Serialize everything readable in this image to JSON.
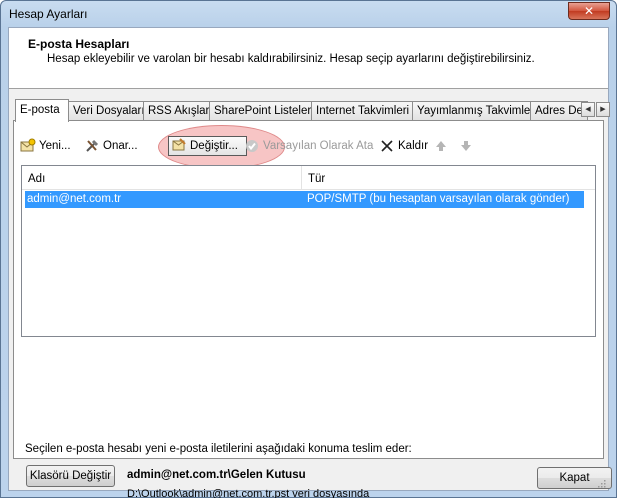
{
  "window": {
    "title": "Hesap Ayarları",
    "close_glyph": "✕"
  },
  "header": {
    "title": "E-posta Hesapları",
    "description": "Hesap ekleyebilir ve varolan bir hesabı kaldırabilirsiniz. Hesap seçip ayarlarını değiştirebilirsiniz."
  },
  "tabs": [
    {
      "label": "E-posta",
      "active": true
    },
    {
      "label": "Veri Dosyaları"
    },
    {
      "label": "RSS Akışları"
    },
    {
      "label": "SharePoint Listeleri"
    },
    {
      "label": "Internet Takvimleri"
    },
    {
      "label": "Yayımlanmış Takvimler"
    },
    {
      "label": "Adres De"
    }
  ],
  "toolbar": {
    "new": "Yeni...",
    "repair": "Onar...",
    "change": "Değiştir...",
    "set_default": "Varsayılan Olarak Ata",
    "remove": "Kaldır"
  },
  "table": {
    "columns": [
      "Adı",
      "Tür"
    ],
    "rows": [
      {
        "name": "admin@net.com.tr",
        "type": "POP/SMTP (bu hesaptan varsayılan olarak gönder)"
      }
    ]
  },
  "delivery": {
    "label": "Seçilen e-posta hesabı yeni e-posta iletilerini aşağıdaki konuma teslim eder:",
    "change_folder_button": "Klasörü Değiştir",
    "location": "admin@net.com.tr\\Gelen Kutusu",
    "path": "D:\\Outlook\\admin@net.com.tr.pst veri dosyasında"
  },
  "footer": {
    "close_button": "Kapat"
  },
  "colors": {
    "selection": "#3399ff",
    "highlight": "#f09696",
    "titlebar": "#b9d1ea"
  }
}
